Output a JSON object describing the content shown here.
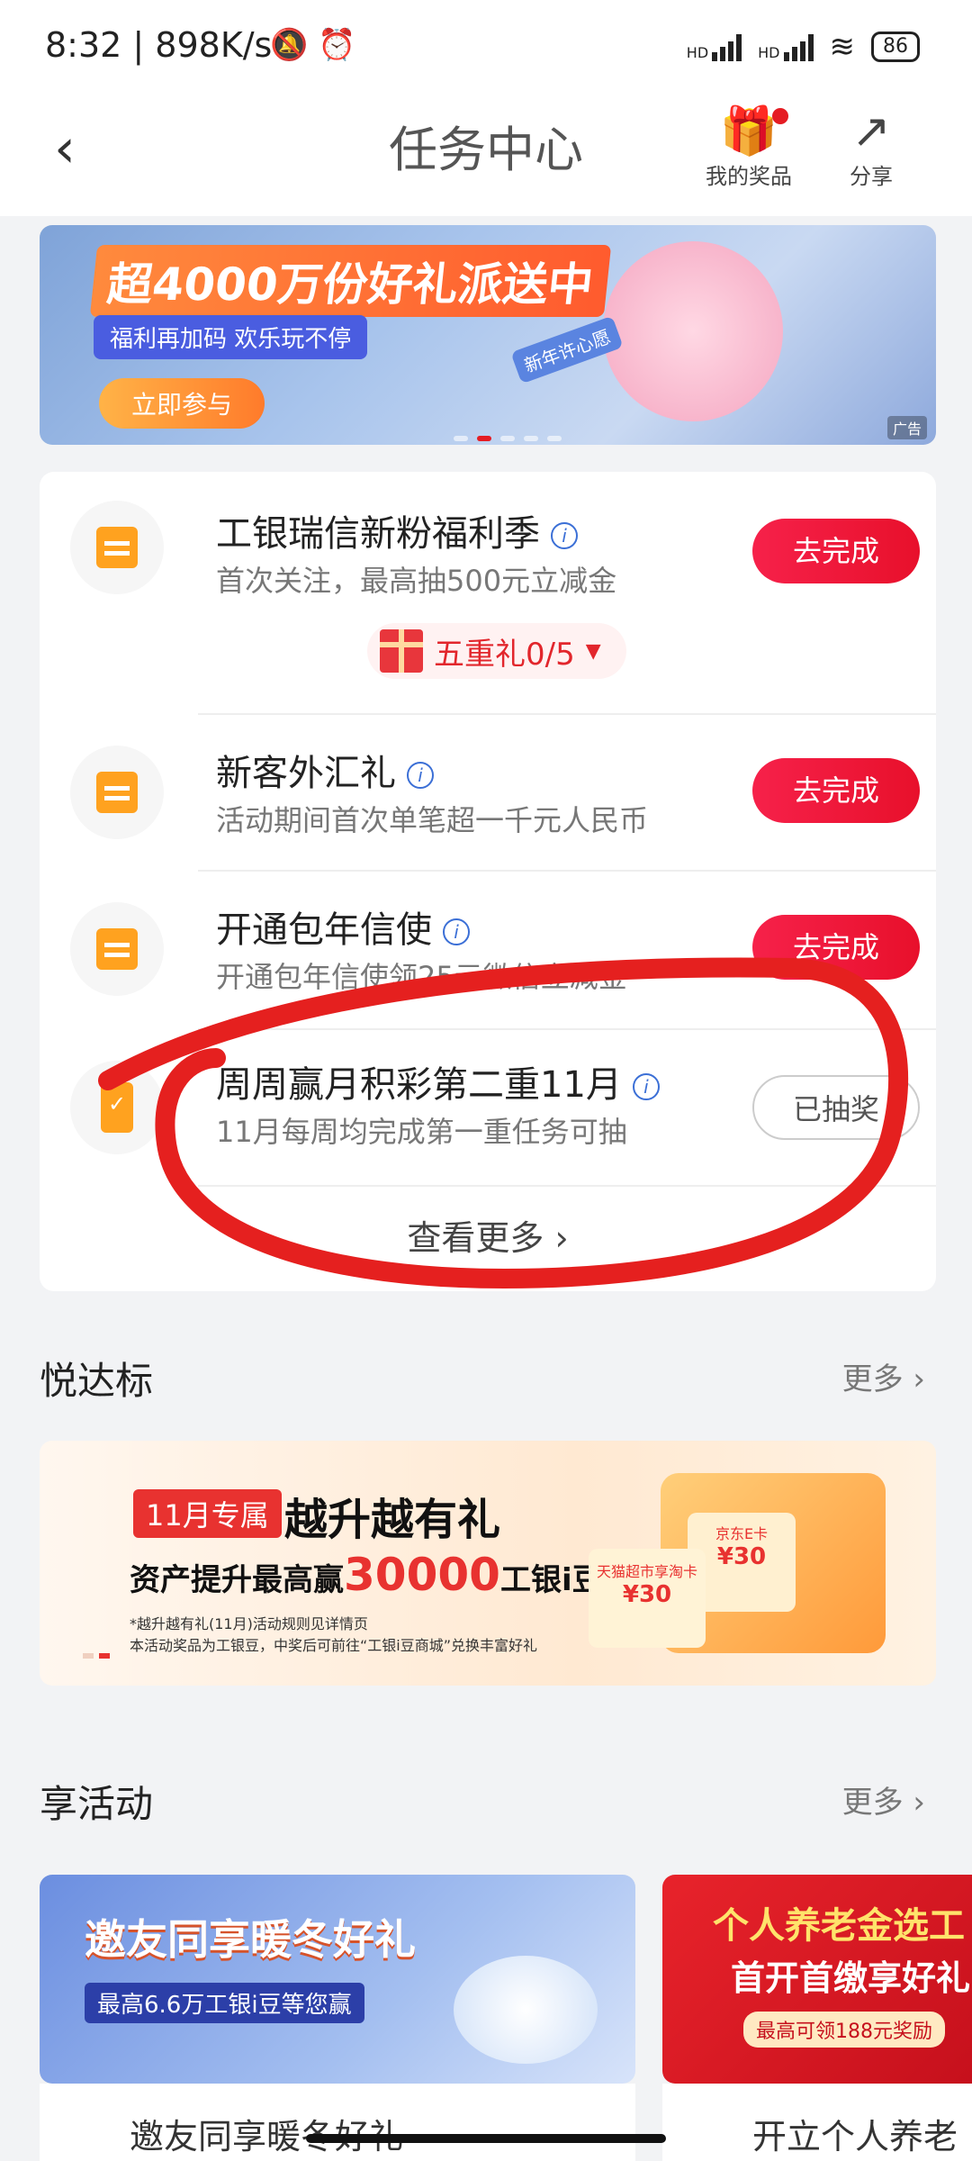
{
  "status_bar": {
    "time_speed": "8:32 | 898K/s",
    "network1": "HD",
    "network2": "HD",
    "battery": "86"
  },
  "header": {
    "title": "任务中心",
    "prizes_label": "我的奖品",
    "share_label": "分享"
  },
  "banner": {
    "headline": "超4000万份好礼派送中",
    "subline": "福利再加码 欢乐玩不停",
    "cta": "立即参与",
    "tag": "新年许心愿",
    "ad_label": "广告"
  },
  "tasks": [
    {
      "title": "工银瑞信新粉福利季",
      "desc": "首次关注，最高抽500元立减金",
      "button": "去完成",
      "icon": "calendar-icon"
    },
    {
      "title": "新客外汇礼",
      "desc": "活动期间首次单笔超一千元人民币",
      "button": "去完成",
      "icon": "calendar-icon"
    },
    {
      "title": "开通包年信使",
      "desc": "开通包年信使领25元微信立减金",
      "button": "去完成",
      "icon": "calendar-icon"
    },
    {
      "title": "周周赢月积彩第二重11月",
      "desc": "11月每周均完成第一重任务可抽",
      "button": "已抽奖",
      "icon": "phone-check-icon"
    }
  ],
  "prize_badge": "五重礼0/5",
  "view_more": "查看更多 ›",
  "section1": {
    "title": "悦达标",
    "more": "更多 ›",
    "promo": {
      "tag": "11月专属",
      "headline": "越升越有礼",
      "line_prefix": "资产提升最高赢",
      "line_number": "30000",
      "line_suffix": "工银i豆",
      "note1": "*越升越有礼(11月)活动规则见详情页",
      "note2": "本活动奖品为工银豆，中奖后可前往“工银i豆商城”兑换丰富好礼",
      "card1_title": "京东E卡",
      "card1_value": "¥30",
      "card2_title": "天猫超市享淘卡",
      "card2_value": "¥30"
    }
  },
  "section2": {
    "title": "享活动",
    "more": "更多 ›",
    "card1": {
      "headline": "邀友同享暖冬好礼",
      "sub": "最高6.6万工银i豆等您赢",
      "caption": "邀友同享暖冬好礼"
    },
    "card2": {
      "headline1": "个人养老金选工",
      "headline2": "首开首缴享好礼",
      "sub": "最高可领188元奖励",
      "caption": "开立个人养老"
    }
  },
  "colors": {
    "accent_red": "#e8102b",
    "icon_orange": "#ffa21f",
    "annotation_red": "#e5201f"
  }
}
